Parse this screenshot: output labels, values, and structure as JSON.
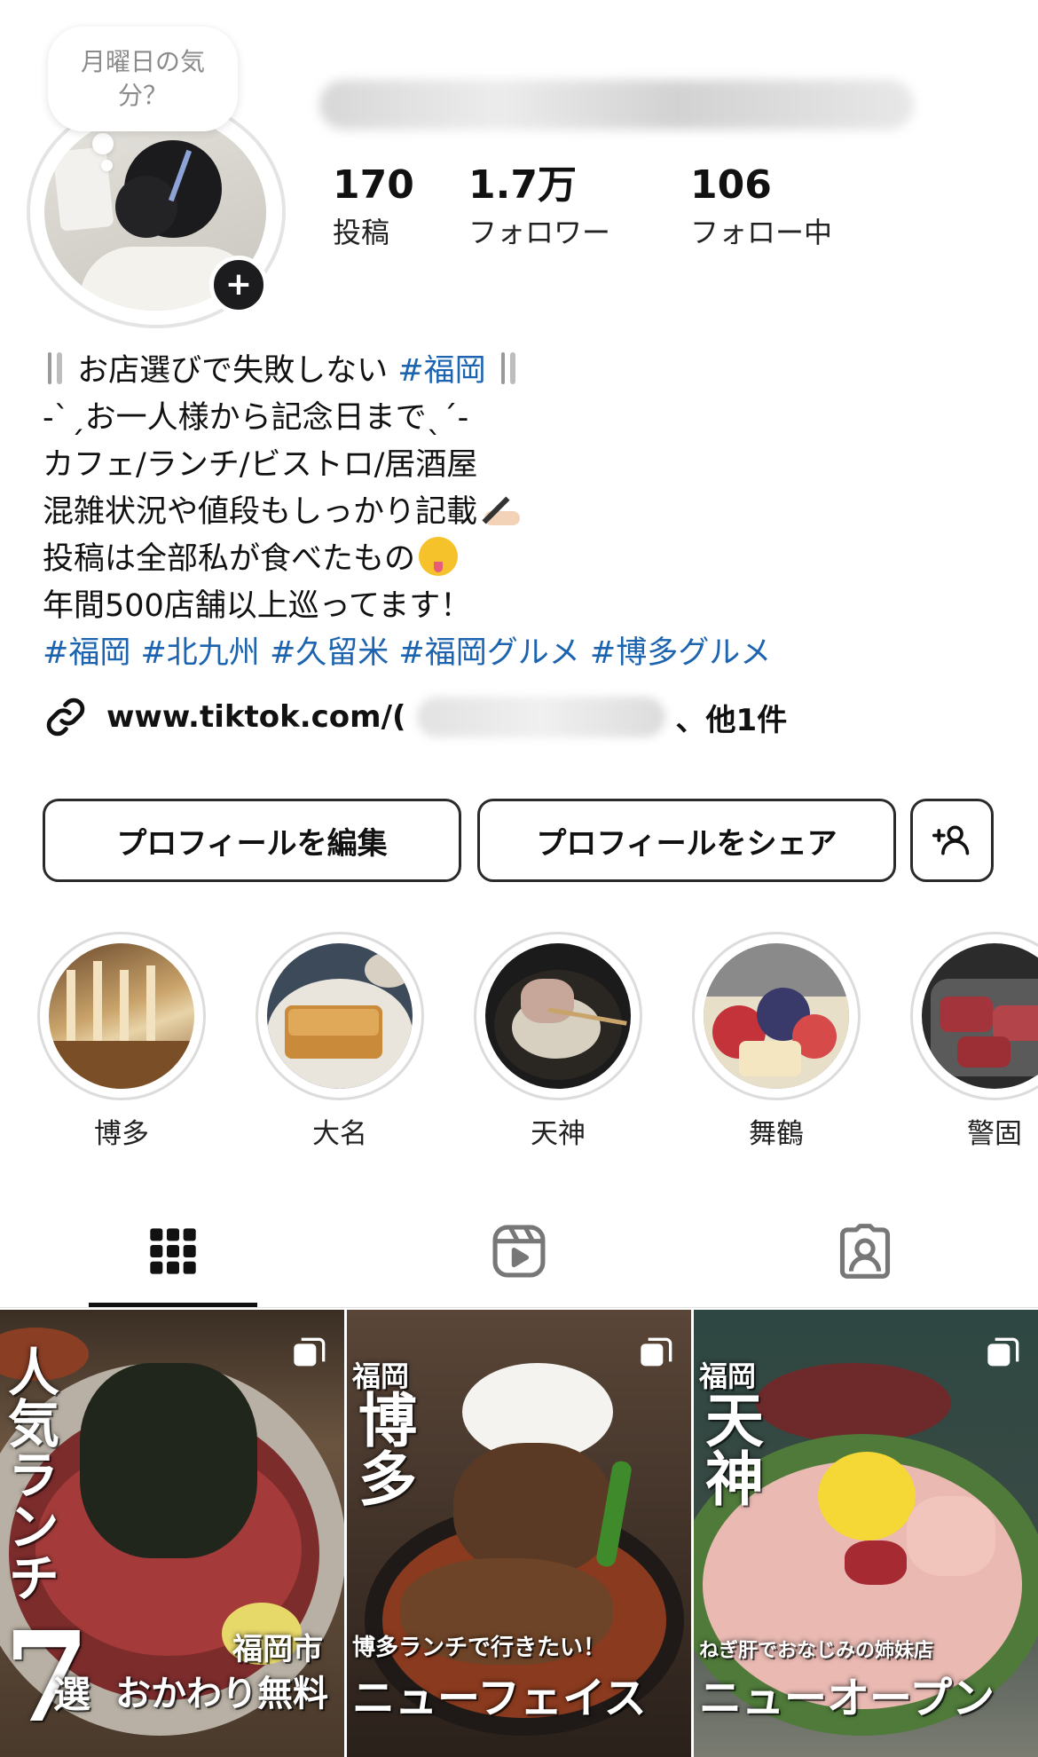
{
  "profile": {
    "status_note": "月曜日の気分？",
    "add_story_symbol": "+"
  },
  "stats": [
    {
      "value": "170",
      "label": "投稿"
    },
    {
      "value": "1.7万",
      "label": "フォロワー"
    },
    {
      "value": "106",
      "label": "フォロー中"
    }
  ],
  "bio": {
    "line1_text": "お店選びで失敗しない ",
    "line1_tag": "#福岡",
    "line2": "-ˋˏお一人様から記念日までˎˊ-",
    "line3": "カフェ/ランチ/ビストロ/居酒屋",
    "line4": "混雑状況や値段もしっかり記載",
    "line5": "投稿は全部私が食べたもの",
    "line6": "年間500店舗以上巡ってます！",
    "hashtags": [
      "#福岡",
      "#北九州",
      "#久留米",
      "#福岡グルメ",
      "#博多グルメ"
    ],
    "link_prefix": "www.tiktok.com/(",
    "link_suffix": "、他1件"
  },
  "buttons": {
    "edit": "プロフィールを編集",
    "share": "プロフィールをシェア"
  },
  "highlights": [
    {
      "label": "博多"
    },
    {
      "label": "大名"
    },
    {
      "label": "天神"
    },
    {
      "label": "舞鶴"
    },
    {
      "label": "警固"
    }
  ],
  "posts": [
    {
      "side_text": "人気ランチ",
      "number": "7",
      "number_suffix": "選",
      "corner": "福岡市",
      "caption": "おかわり無料"
    },
    {
      "area_small": "福岡",
      "area_big": "博多",
      "sub": "博多ランチで行きたい！",
      "caption": "ニューフェイス"
    },
    {
      "area_small": "福岡",
      "area_big": "天神",
      "sub": "ねぎ肝でおなじみの姉妹店",
      "caption": "ニューオープン"
    }
  ],
  "colors": {
    "hashtag": "#1d64b0",
    "text": "#111111",
    "muted": "#8b8b8b"
  },
  "icons": [
    "plus-icon",
    "link-icon",
    "add-person-icon",
    "grid-icon",
    "reels-icon",
    "tagged-icon",
    "carousel-icon",
    "fork-knife-icon"
  ]
}
